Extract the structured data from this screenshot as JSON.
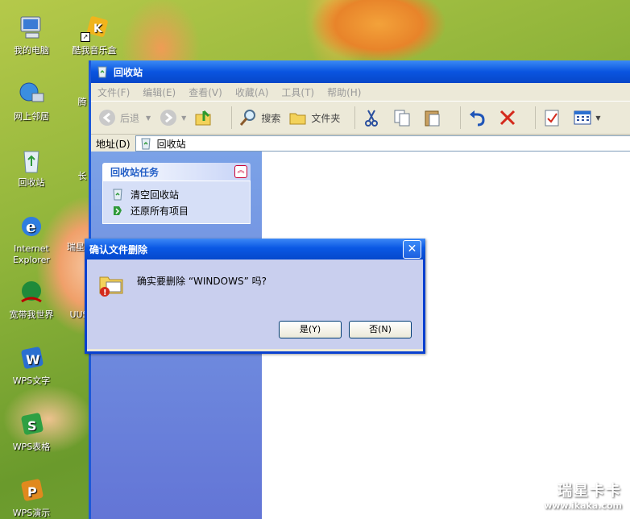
{
  "desktop": {
    "icons": [
      {
        "label": "我的电脑"
      },
      {
        "label": "网上邻居"
      },
      {
        "label": "回收站"
      },
      {
        "label": "Internet Explorer"
      },
      {
        "label": "宽带我世界"
      },
      {
        "label": "WPS文字"
      },
      {
        "label": "WPS表格"
      },
      {
        "label": "WPS演示"
      },
      {
        "label": "酷我音乐盒"
      },
      {
        "label": "腾"
      },
      {
        "label": "长"
      },
      {
        "label": "瑞星"
      },
      {
        "label": "UUS"
      }
    ]
  },
  "window": {
    "title": "回收站",
    "menu": [
      "文件(F)",
      "编辑(E)",
      "查看(V)",
      "收藏(A)",
      "工具(T)",
      "帮助(H)"
    ],
    "toolbar": {
      "back": "后退",
      "search": "搜索",
      "folders": "文件夹"
    },
    "address": {
      "label": "地址(D)",
      "value": "回收站"
    },
    "tasks": {
      "title": "回收站任务",
      "items": [
        "清空回收站",
        "还原所有项目"
      ]
    }
  },
  "dialog": {
    "title": "确认文件删除",
    "message": "确实要删除 “WINDOWS” 吗?",
    "yes": "是(Y)",
    "no": "否(N)"
  },
  "watermark": {
    "brand": "瑞星卡卡",
    "url": "www.ikaka.com"
  }
}
